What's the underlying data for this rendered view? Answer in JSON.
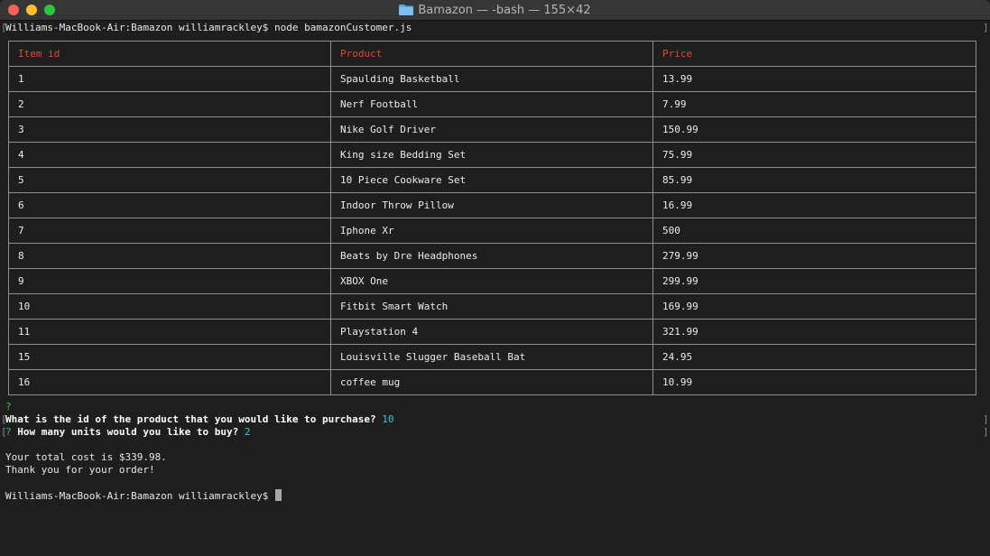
{
  "window": {
    "title": "Bamazon — -bash — 155×42"
  },
  "terminal": {
    "prompt_line": "Williams-MacBook-Air:Bamazon williamrackley$ node bamazonCustomer.js",
    "table": {
      "headers": [
        "Item id",
        "Product",
        "Price"
      ],
      "rows": [
        [
          "1",
          "Spaulding Basketball",
          "13.99"
        ],
        [
          "2",
          "Nerf Football",
          "7.99"
        ],
        [
          "3",
          "Nike Golf Driver",
          "150.99"
        ],
        [
          "4",
          "King size Bedding Set",
          "75.99"
        ],
        [
          "5",
          "10 Piece Cookware Set",
          "85.99"
        ],
        [
          "6",
          "Indoor Throw Pillow",
          "16.99"
        ],
        [
          "7",
          "Iphone Xr",
          "500"
        ],
        [
          "8",
          "Beats by Dre Headphones",
          "279.99"
        ],
        [
          "9",
          "XBOX One",
          "299.99"
        ],
        [
          "10",
          "Fitbit Smart Watch",
          "169.99"
        ],
        [
          "11",
          "Playstation 4",
          "321.99"
        ],
        [
          "15",
          "Louisville Slugger Baseball Bat",
          "24.95"
        ],
        [
          "16",
          "coffee mug",
          "10.99"
        ]
      ]
    },
    "q_mark": "?",
    "question1": "What is the id of the product that you would like to purchase?",
    "answer1": "10",
    "question2_prefix": "?",
    "question2": "How many units would you like to buy?",
    "answer2": "2",
    "total_line": "Your total cost is $339.98.",
    "thanks_line": "Thank you for your order!",
    "final_prompt": "Williams-MacBook-Air:Bamazon williamrackley$"
  },
  "colors": {
    "header_text": "#e5482d",
    "answer_text": "#3fc5d5",
    "question_mark": "#33c24a",
    "background": "#1e1e1e"
  },
  "icons": {
    "title_folder": "folder-icon"
  }
}
